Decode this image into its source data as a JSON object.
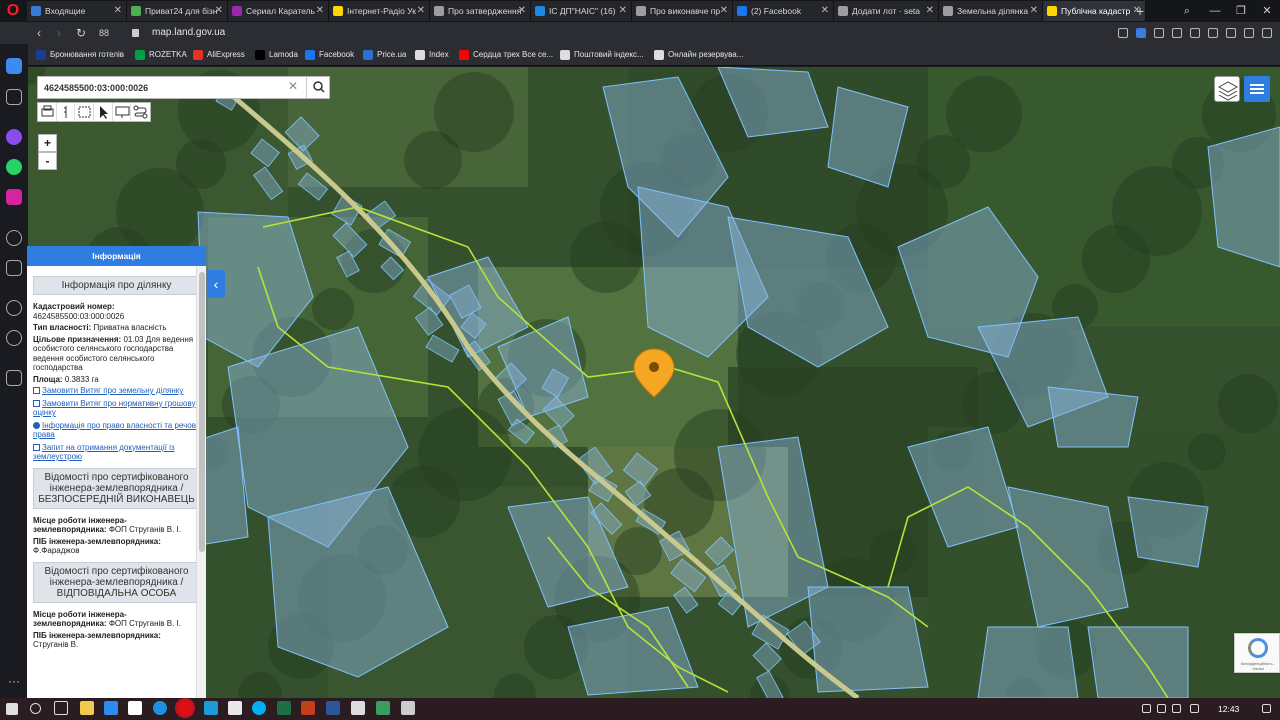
{
  "browser": {
    "tabs": [
      {
        "title": "Входящие",
        "color": "#3a7bd5"
      },
      {
        "title": "Приват24 для бізн",
        "color": "#4caf50"
      },
      {
        "title": "Сериал Каратель",
        "color": "#9c27b0"
      },
      {
        "title": "Інтернет-Радіо Ук",
        "color": "#ffd600"
      },
      {
        "title": "Про затвердження",
        "color": "#9e9e9e"
      },
      {
        "title": "ІС ДП\"НАІС\" (16)",
        "color": "#1e88e5"
      },
      {
        "title": "Про виконавче пр",
        "color": "#9e9e9e"
      },
      {
        "title": "(2) Facebook",
        "color": "#1877f2"
      },
      {
        "title": "Додати лот · seta",
        "color": "#9e9e9e"
      },
      {
        "title": "Земельна ділянка",
        "color": "#9e9e9e"
      },
      {
        "title": "Публічна кадастр",
        "color": "#ffd600"
      }
    ],
    "tab_count": "88",
    "url": "map.land.gov.ua",
    "bookmarks": [
      {
        "label": "Бронювання готелів",
        "color": "#1a3d8f"
      },
      {
        "label": "ROZETKA",
        "color": "#00a046"
      },
      {
        "label": "AliExpress",
        "color": "#e43225"
      },
      {
        "label": "Lamoda",
        "color": "#000000"
      },
      {
        "label": "Facebook",
        "color": "#1877f2"
      },
      {
        "label": "Price.ua",
        "color": "#2f6fd0"
      },
      {
        "label": "Index",
        "color": "#dddddd"
      },
      {
        "label": "Сердца трех Все се...",
        "color": "#ff0000"
      },
      {
        "label": "Поштовий індекс...",
        "color": "#dddddd"
      },
      {
        "label": "Онлайн резервува...",
        "color": "#dddddd"
      }
    ]
  },
  "map": {
    "search_value": "4624585500:03:000:0026",
    "zoom_in": "+",
    "zoom_out": "-",
    "scale": "",
    "recaptcha_text": "Конфіденційність - Умови",
    "accent": "#2f7de1"
  },
  "panel": {
    "header": "Інформація",
    "section1_title": "Інформація про ділянку",
    "cadastral_label": "Кадастровий номер:",
    "cadastral_value": "4624585500:03:000:0026",
    "ownership_label": "Тип власності:",
    "ownership_value": "Приватна власність",
    "purpose_label": "Цільове призначення:",
    "purpose_value": "01.03 Для ведення особистого селянського господарства ведення особистого селянського господарства",
    "area_label": "Площа:",
    "area_value": "0.3833 га",
    "links": [
      "Замовити Витяг про земельну ділянку",
      "Замовити Витяг про нормативну грошову оцінку",
      "Інформація про право власності та речові права",
      "Запит на отримання документації із землеустрою"
    ],
    "section2_title": "Відомості про сертифікованого інженера-землевпорядника / БЕЗПОСЕРЕДНІЙ ВИКОНАВЕЦЬ",
    "workplace_label": "Місце роботи інженера-землевпорядника:",
    "workplace_value": "ФОП Струганів В. І.",
    "engineer_label": "ПІБ інженера-землевпорядника:",
    "engineer_value": "Ф.Фараджов",
    "section3_title": "Відомості про сертифікованого інженера-землевпорядника / ВІДПОВІДАЛЬНА ОСОБА",
    "workplace2_label": "Місце роботи інженера-землевпорядника:",
    "workplace2_value": "ФОП Струганів В. І.",
    "engineer2_label": "ПІБ інженера-землевпорядника:",
    "engineer2_value": "Струганів В."
  },
  "taskbar": {
    "clock": "12:43"
  }
}
